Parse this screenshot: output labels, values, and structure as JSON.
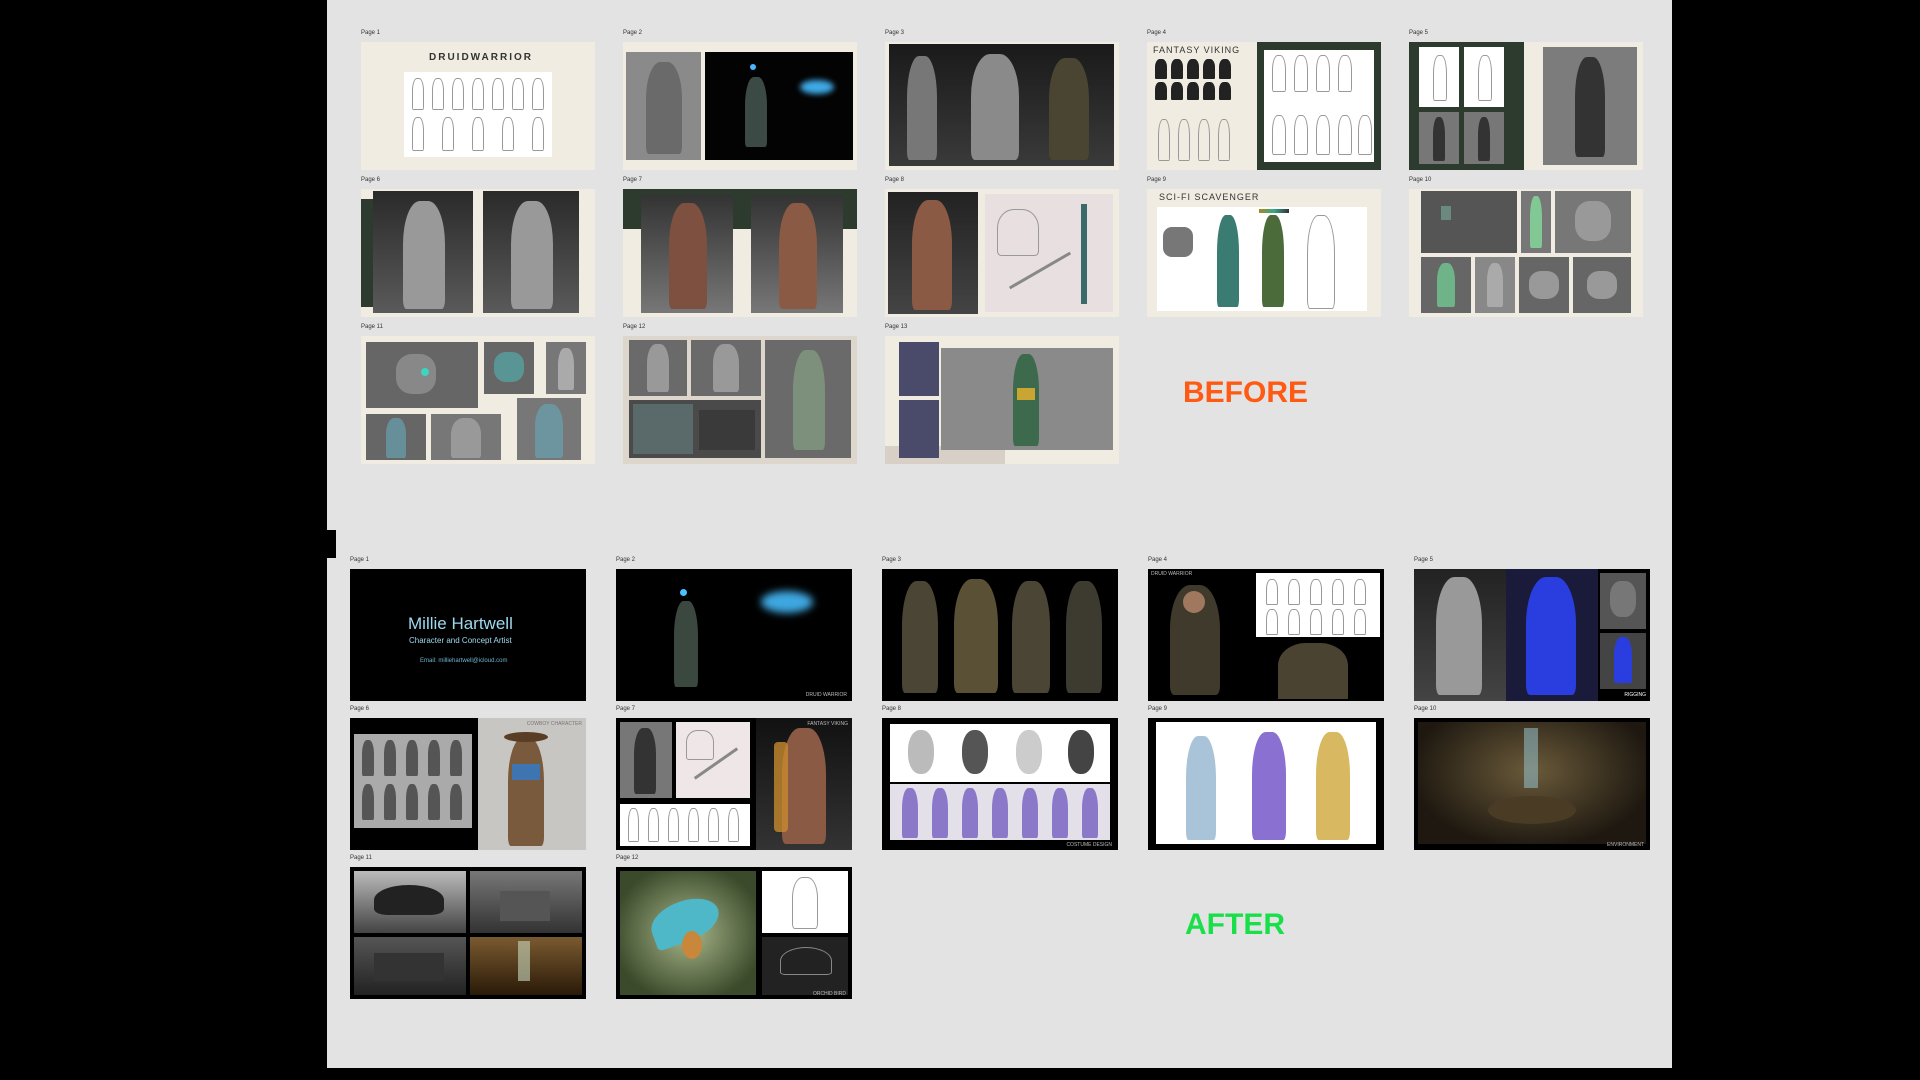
{
  "labels": {
    "before": "BEFORE",
    "after": "AFTER"
  },
  "before_pages": [
    {
      "label": "Page 1",
      "title": "DRUIDWARRIOR"
    },
    {
      "label": "Page 2"
    },
    {
      "label": "Page 3"
    },
    {
      "label": "Page 4",
      "title": "FANTASY VIKING"
    },
    {
      "label": "Page 5"
    },
    {
      "label": "Page 6"
    },
    {
      "label": "Page 7"
    },
    {
      "label": "Page 8"
    },
    {
      "label": "Page 9",
      "title": "SCI-FI SCAVENGER"
    },
    {
      "label": "Page 10"
    },
    {
      "label": "Page 11"
    },
    {
      "label": "Page 12"
    },
    {
      "label": "Page 13"
    }
  ],
  "after_pages": [
    {
      "label": "Page 1",
      "name": "Millie Hartwell",
      "subtitle": "Character and Concept Artist",
      "email": "Email: milliehartwell@icloud.com"
    },
    {
      "label": "Page 2",
      "caption": "DRUID WARRIOR"
    },
    {
      "label": "Page 3"
    },
    {
      "label": "Page 4",
      "caption": "DRUID WARRIOR"
    },
    {
      "label": "Page 5",
      "caption": "RIGGING"
    },
    {
      "label": "Page 6",
      "caption": "COWBOY CHARACTER"
    },
    {
      "label": "Page 7",
      "caption": "FANTASY VIKING"
    },
    {
      "label": "Page 8",
      "caption": "COSTUME DESIGN"
    },
    {
      "label": "Page 9"
    },
    {
      "label": "Page 10",
      "caption": "ENVIRONMENT"
    },
    {
      "label": "Page 11"
    },
    {
      "label": "Page 12",
      "caption": "ORCHID BIRD"
    }
  ]
}
